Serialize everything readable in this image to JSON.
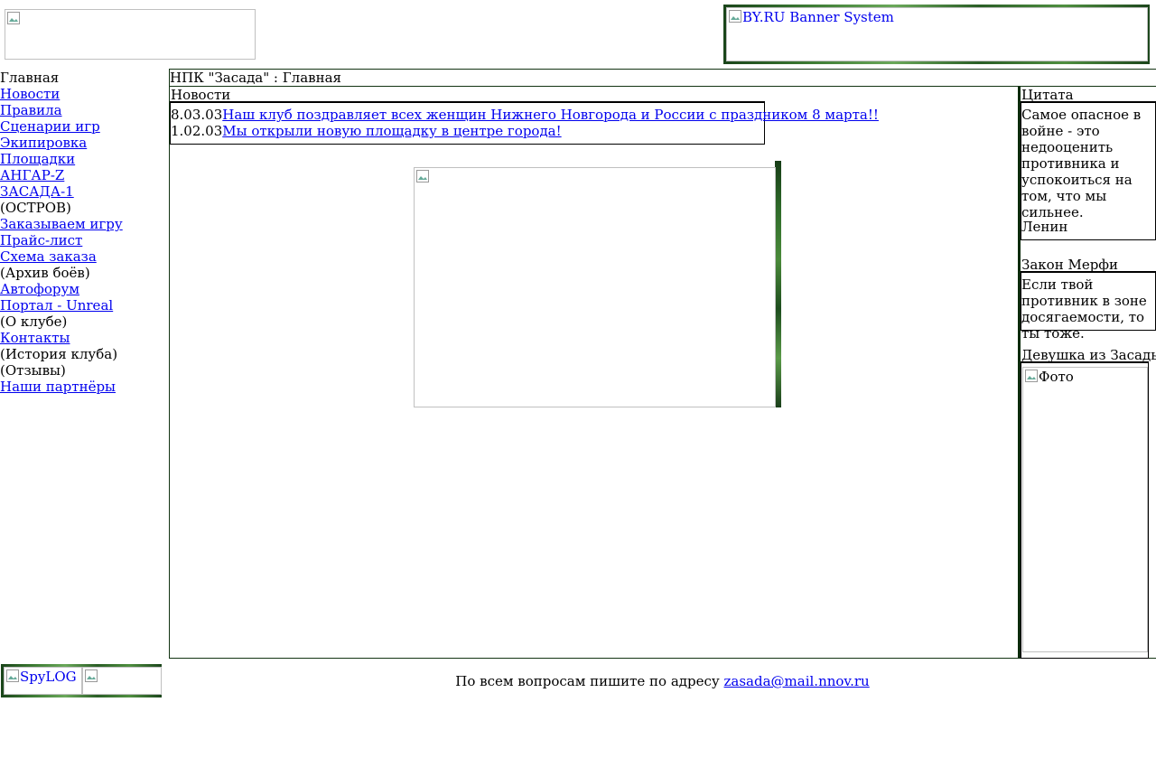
{
  "header": {
    "banner_alt": "BY.RU Banner System"
  },
  "nav": {
    "items": [
      {
        "label": "Главная",
        "link": false
      },
      {
        "label": "Новости",
        "link": true
      },
      {
        "label": "Правила",
        "link": true
      },
      {
        "label": "Сценарии игр",
        "link": true
      },
      {
        "label": "Экипировка",
        "link": true
      },
      {
        "label": "Площадки",
        "link": true
      },
      {
        "label": "АНГАР-Z",
        "link": true
      },
      {
        "label": "ЗАСАДА-1",
        "link": true
      },
      {
        "label": "(ОСТРОВ)",
        "link": false
      },
      {
        "label": "Заказываем игру",
        "link": true
      },
      {
        "label": "Прайс-лист",
        "link": true
      },
      {
        "label": "Схема заказа",
        "link": true
      },
      {
        "label": "(Архив боёв)",
        "link": false
      },
      {
        "label": "Автофорум",
        "link": true
      },
      {
        "label": "Портал - Unreal",
        "link": true
      },
      {
        "label": "(О клубе)",
        "link": false
      },
      {
        "label": "Контакты",
        "link": true
      },
      {
        "label": "(История клуба)",
        "link": false
      },
      {
        "label": "(Отзывы)",
        "link": false
      },
      {
        "label": "Наши партнёры",
        "link": true
      }
    ]
  },
  "main": {
    "breadcrumb": "НПК \"Засада\" : Главная",
    "news_title": "Новости",
    "news": [
      {
        "date": "8.03.03",
        "text": "Наш клуб поздравляет всех женщин Нижнего Новгорода и России с праздником 8 марта!!"
      },
      {
        "date": "1.02.03",
        "text": "Мы открыли новую площадку в центре города!"
      }
    ]
  },
  "sidebar": {
    "quote_title": "Цитата",
    "quote_text": "Самое опасное в войне - это недооценить противника и успокоиться на том, что мы сильнее.",
    "quote_author": "Ленин",
    "murphy_title": "Закон Мерфи",
    "murphy_text": "Если твой противник в зоне досягаемости, то ты тоже.",
    "girl_title": "Девушка из Засады",
    "photo_alt": "Фото"
  },
  "footer": {
    "spylog_alt": "SpyLOG",
    "contact_text": "По всем вопросам пишите по адресу ",
    "email": "zasada@mail.nnov.ru"
  }
}
